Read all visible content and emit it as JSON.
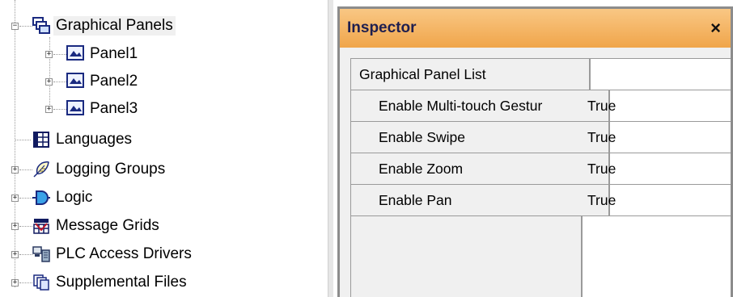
{
  "tree": {
    "graphical_panels": "Graphical Panels",
    "panels": [
      "Panel1",
      "Panel2",
      "Panel3"
    ],
    "languages": "Languages",
    "logging_groups": "Logging Groups",
    "logic": "Logic",
    "message_grids": "Message Grids",
    "plc_access_drivers": "PLC Access Drivers",
    "supplemental_files": "Supplemental Files",
    "expand_glyph": "+",
    "collapse_glyph": "−"
  },
  "inspector": {
    "title": "Inspector",
    "close_glyph": "×",
    "section_header": "Graphical Panel List",
    "rows": [
      {
        "name": "Enable Multi-touch Gestur",
        "value": "True"
      },
      {
        "name": "Enable Swipe",
        "value": "True"
      },
      {
        "name": "Enable Zoom",
        "value": "True"
      },
      {
        "name": "Enable Pan",
        "value": "True"
      }
    ]
  },
  "colors": {
    "title_bar": "#f0a54a",
    "grid_line": "#9a9a9a"
  },
  "icons": {
    "graphical_panels": "windows-stack-icon",
    "panel": "panel-window-icon",
    "languages": "language-table-icon",
    "logging_groups": "logging-feather-icon",
    "logic": "logic-gate-icon",
    "message_grids": "message-grid-icon",
    "plc_access_drivers": "plc-driver-icon",
    "supplemental_files": "supplemental-files-icon"
  }
}
